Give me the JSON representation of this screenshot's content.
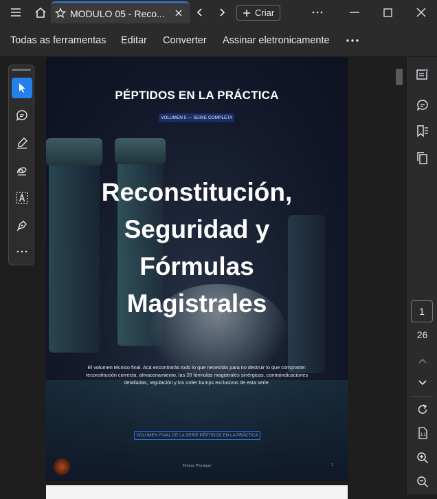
{
  "titlebar": {
    "tab_title": "MODULO 05 - Reco...",
    "new_label": "Criar"
  },
  "toolbar": {
    "items": [
      "Todas as ferramentas",
      "Editar",
      "Converter",
      "Assinar eletronicamente"
    ]
  },
  "document": {
    "header": "PÉPTIDOS EN LA PRÁCTICA",
    "volume_badge": "VOLUMEN 5 — SERIE COMPLETA",
    "title_lines": [
      "Reconstitución,",
      "Seguridad y",
      "Fórmulas",
      "Magistrales"
    ],
    "description_lines": [
      "El volumen técnico final. Acá encontrarás todo lo que necesitás para no destruir lo que compraste:",
      "reconstitución correcta, almacenamiento, las 20 fórmulas magistrales sinérgicas, contraindicaciones",
      "detalladas, regulación y los order bumps exclusivos de esta serie."
    ],
    "footer_badge": "VOLUMEN FINAL DE LA SERIE PÉPTIDOS EN LA PRÁCTICA",
    "footer_brand": "Fitness Physique",
    "page_number": "1",
    "accent_color": "#2f6fd6"
  },
  "navigation": {
    "current_page": "1",
    "total_pages": "26"
  },
  "colors": {
    "active_tool": "#2680eb",
    "chrome": "#2b2b2b"
  }
}
